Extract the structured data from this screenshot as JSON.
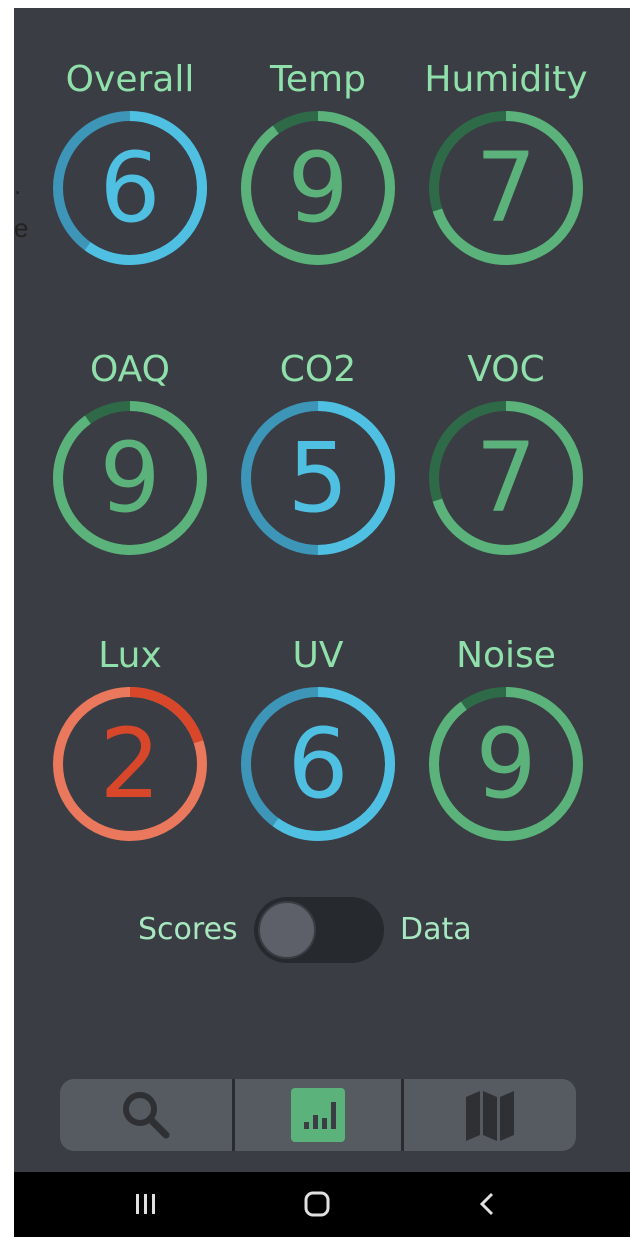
{
  "gauges": [
    {
      "label": "Overall",
      "value": "6",
      "score": 6,
      "tone": "blue"
    },
    {
      "label": "Temp",
      "value": "9",
      "score": 9,
      "tone": "green"
    },
    {
      "label": "Humidity",
      "value": "7",
      "score": 7,
      "tone": "green"
    },
    {
      "label": "OAQ",
      "value": "9",
      "score": 9,
      "tone": "green"
    },
    {
      "label": "CO2",
      "value": "5",
      "score": 5,
      "tone": "blue"
    },
    {
      "label": "VOC",
      "value": "7",
      "score": 7,
      "tone": "green"
    },
    {
      "label": "Lux",
      "value": "2",
      "score": 2,
      "tone": "red"
    },
    {
      "label": "UV",
      "value": "6",
      "score": 6,
      "tone": "blue"
    },
    {
      "label": "Noise",
      "value": "9",
      "score": 9,
      "tone": "green"
    }
  ],
  "score_max": 10,
  "colors": {
    "background": "#3a3d43",
    "green": "#5bb37b",
    "green_dim": "#2f6a48",
    "blue": "#4fc0e2",
    "blue_dim": "#3d95b8",
    "red": "#d9472a",
    "red_light": "#e9785c",
    "label": "#8fe0aa"
  },
  "view_toggle": {
    "left_label": "Scores",
    "right_label": "Data",
    "selected": "Scores"
  },
  "tabs": [
    {
      "name": "search",
      "icon": "search-icon",
      "selected": false
    },
    {
      "name": "stats",
      "icon": "bar-chart-icon",
      "selected": true
    },
    {
      "name": "map",
      "icon": "map-icon",
      "selected": false
    }
  ],
  "system_nav": {
    "recents_icon": "recents-icon",
    "home_icon": "home-icon",
    "back_icon": "back-icon"
  }
}
